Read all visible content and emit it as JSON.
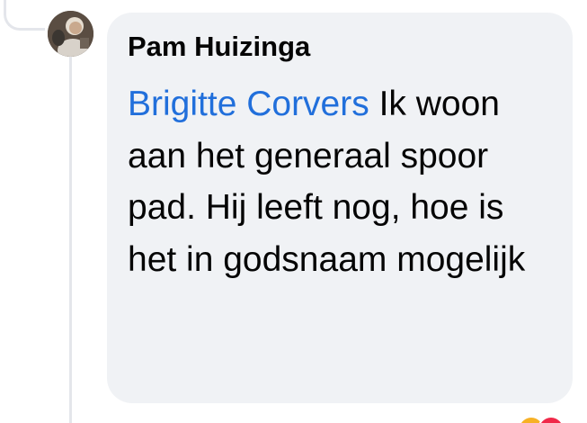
{
  "comment": {
    "author": "Pam Huizinga",
    "mention": "Brigitte Corvers",
    "text": " Ik woon aan het generaal spoor pad. Hij leeft nog, hoe is het in godsnaam mogelijk"
  },
  "colors": {
    "bubble": "#f0f2f5",
    "mention": "#216fdb",
    "text": "#050505",
    "thread_line": "#e4e6eb"
  },
  "icons": {
    "avatar": "profile-photo",
    "reactions": [
      "like-reaction",
      "haha-reaction"
    ]
  }
}
